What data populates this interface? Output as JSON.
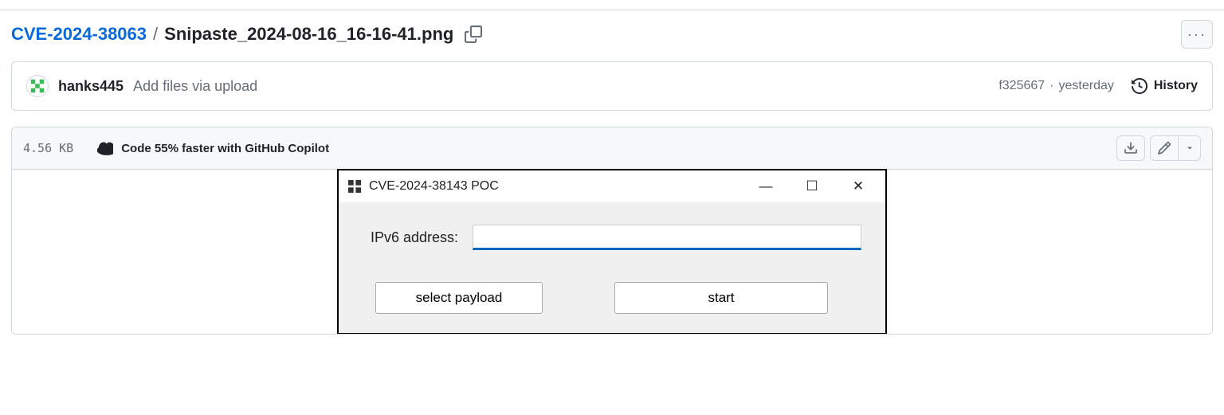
{
  "breadcrumb": {
    "root": "CVE-2024-38063",
    "current": "Snipaste_2024-08-16_16-16-41.png"
  },
  "commit": {
    "author": "hanks445",
    "message": "Add files via upload",
    "sha": "f325667",
    "reltime": "yesterday",
    "history_label": "History"
  },
  "file": {
    "size": "4.56 KB",
    "copilot_promo": "Code 55% faster with GitHub Copilot"
  },
  "dialog": {
    "title": "CVE-2024-38143 POC",
    "field_label": "IPv6 address:",
    "input_value": "",
    "select_btn": "select payload",
    "start_btn": "start"
  }
}
